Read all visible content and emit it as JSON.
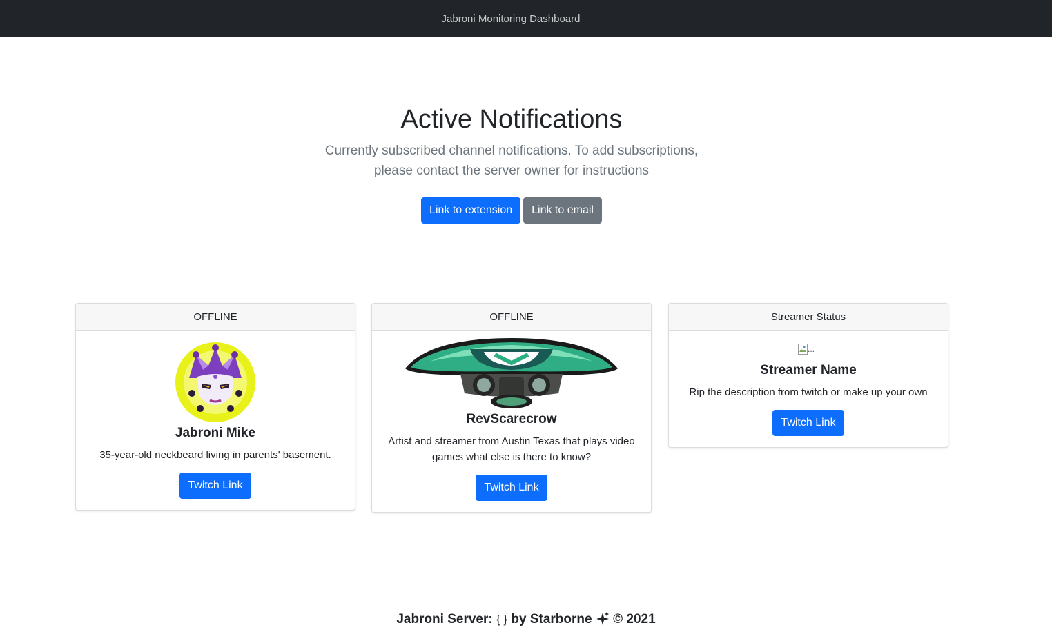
{
  "navbar": {
    "title": "Jabroni Monitoring Dashboard"
  },
  "hero": {
    "title": "Active Notifications",
    "lead": "Currently subscribed channel notifications. To add subscriptions, please contact the server owner for instructions",
    "buttons": {
      "extension": "Link to extension",
      "email": "Link to email"
    }
  },
  "cards": [
    {
      "status": "OFFLINE",
      "name": "Jabroni Mike",
      "description": "35-year-old neckbeard living in parents' basement.",
      "button": "Twitch Link",
      "avatar_icon": "jester-mask-avatar"
    },
    {
      "status": "OFFLINE",
      "name": "RevScarecrow",
      "description": "Artist and streamer from Austin Texas that plays video games what else is there to know?",
      "button": "Twitch Link",
      "avatar_icon": "mushroom-gasmask-avatar"
    },
    {
      "status": "Streamer Status",
      "name": "Streamer Name",
      "description": "Rip the description from twitch or make up your own",
      "button": "Twitch Link",
      "image_alt": "..."
    }
  ],
  "footer": {
    "prefix": "Jabroni Server:",
    "code_symbol": "{ }",
    "by": "by Starborne",
    "copyright": "© 2021"
  },
  "colors": {
    "navbar_bg": "#212529",
    "primary": "#0d6efd",
    "secondary": "#6c757d"
  }
}
